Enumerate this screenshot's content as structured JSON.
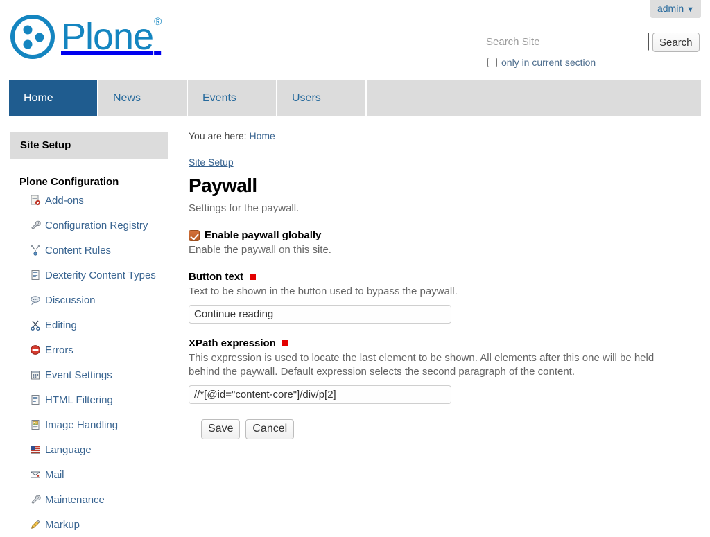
{
  "personal_bar": {
    "user_label": "admin",
    "caret": "▼"
  },
  "logo": {
    "wordmark": "Plone",
    "registered_mark": "®"
  },
  "search": {
    "placeholder": "Search Site",
    "value": "",
    "submit_label": "Search",
    "scope_label": "only in current section",
    "scope_checked": false
  },
  "globalnav": {
    "items": [
      {
        "label": "Home",
        "selected": true
      },
      {
        "label": "News",
        "selected": false
      },
      {
        "label": "Events",
        "selected": false
      },
      {
        "label": "Users",
        "selected": false
      }
    ]
  },
  "sidebar": {
    "header": "Site Setup",
    "section_title": "Plone Configuration",
    "items": [
      {
        "label": "Add-ons",
        "icon": "addons-icon"
      },
      {
        "label": "Configuration Registry",
        "icon": "wrench-icon"
      },
      {
        "label": "Content Rules",
        "icon": "content-rules-icon"
      },
      {
        "label": "Dexterity Content Types",
        "icon": "document-icon"
      },
      {
        "label": "Discussion",
        "icon": "speech-bubble-icon"
      },
      {
        "label": "Editing",
        "icon": "scissors-icon"
      },
      {
        "label": "Errors",
        "icon": "error-icon"
      },
      {
        "label": "Event Settings",
        "icon": "calendar-icon"
      },
      {
        "label": "HTML Filtering",
        "icon": "document-icon"
      },
      {
        "label": "Image Handling",
        "icon": "image-icon"
      },
      {
        "label": "Language",
        "icon": "flag-icon"
      },
      {
        "label": "Mail",
        "icon": "envelope-icon"
      },
      {
        "label": "Maintenance",
        "icon": "wrench-icon"
      },
      {
        "label": "Markup",
        "icon": "pencil-icon"
      }
    ]
  },
  "breadcrumbs": {
    "prefix": "You are here:",
    "home_label": "Home"
  },
  "content": {
    "parent_link": "Site Setup",
    "title": "Paywall",
    "description": "Settings for the paywall.",
    "fields": [
      {
        "type": "checkbox",
        "label": "Enable paywall globally",
        "help": "Enable the paywall on this site.",
        "checked": true,
        "required": false
      },
      {
        "type": "text",
        "label": "Button text",
        "help": "Text to be shown in the button used to bypass the paywall.",
        "value": "Continue reading",
        "required": true
      },
      {
        "type": "text",
        "label": "XPath expression",
        "help": "This expression is used to locate the last element to be shown. All elements after this one will be held behind the paywall. Default expression selects the second paragraph of the content.",
        "value": "//*[@id=\"content-core\"]/div/p[2]",
        "required": true
      }
    ],
    "actions": {
      "save_label": "Save",
      "cancel_label": "Cancel"
    }
  },
  "colors": {
    "brand_blue": "#1485c0",
    "nav_active": "#1f5c8f",
    "link_blue": "#3a6591",
    "nav_bg": "#dcdcdc",
    "required_red": "#e30000",
    "checkbox_orange": "#b85c25"
  }
}
